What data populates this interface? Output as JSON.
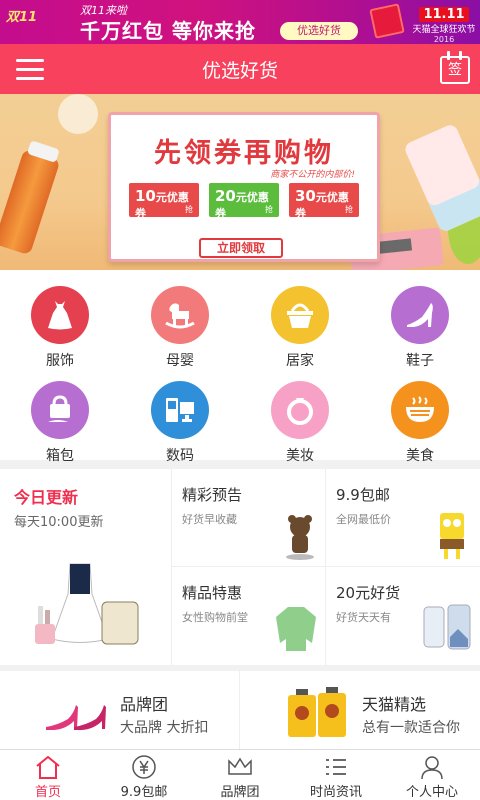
{
  "promo": {
    "tag": "双11",
    "line1": "双11来啦",
    "line2": "千万红包 等你来抢",
    "button": "优选好货",
    "tmall_title": "11.11",
    "tmall_sub": "天猫全球狂欢节",
    "tmall_year": "2016"
  },
  "header": {
    "title": "优选好货",
    "sign_label": "签"
  },
  "hero": {
    "headline": "先领券再购物",
    "sub": "商家不公开的内部价!",
    "coupons": [
      {
        "amount": "10",
        "text": "元优惠券",
        "tag": "抢"
      },
      {
        "amount": "20",
        "text": "元优惠券",
        "tag": "抢"
      },
      {
        "amount": "30",
        "text": "元优惠券",
        "tag": "抢"
      }
    ],
    "cta": "立即领取"
  },
  "categories": [
    {
      "label": "服饰",
      "icon": "dress-icon",
      "color": "#e5404f"
    },
    {
      "label": "母婴",
      "icon": "rocking-horse-icon",
      "color": "#f37a7a"
    },
    {
      "label": "居家",
      "icon": "basket-icon",
      "color": "#f5c22f"
    },
    {
      "label": "鞋子",
      "icon": "high-heel-icon",
      "color": "#b66ed1"
    },
    {
      "label": "箱包",
      "icon": "handbag-icon",
      "color": "#b66ed1"
    },
    {
      "label": "数码",
      "icon": "devices-icon",
      "color": "#2f8fd8"
    },
    {
      "label": "美妆",
      "icon": "ring-icon",
      "color": "#f7a1c6"
    },
    {
      "label": "美食",
      "icon": "bowl-icon",
      "color": "#f5921e"
    }
  ],
  "modules": {
    "today": {
      "title": "今日更新",
      "sub": "每天10:00更新"
    },
    "cells": [
      {
        "title": "精彩预告",
        "sub": "好货早收藏"
      },
      {
        "title": "9.9包邮",
        "sub": "全网最低价"
      },
      {
        "title": "精品特惠",
        "sub": "女性购物前堂"
      },
      {
        "title": "20元好货",
        "sub": "好货天天有"
      }
    ]
  },
  "brands": [
    {
      "title": "品牌团",
      "sub": "大品牌 大折扣"
    },
    {
      "title": "天猫精选",
      "sub": "总有一款适合你"
    }
  ],
  "nav": [
    {
      "label": "首页",
      "icon": "home-icon",
      "active": true
    },
    {
      "label": "9.9包邮",
      "icon": "yuan-icon",
      "active": false
    },
    {
      "label": "品牌团",
      "icon": "crown-icon",
      "active": false
    },
    {
      "label": "时尚资讯",
      "icon": "list-icon",
      "active": false
    },
    {
      "label": "个人中心",
      "icon": "person-icon",
      "active": false
    }
  ],
  "colors": {
    "brand": "#f8425d",
    "accent": "#ef2f4f"
  }
}
